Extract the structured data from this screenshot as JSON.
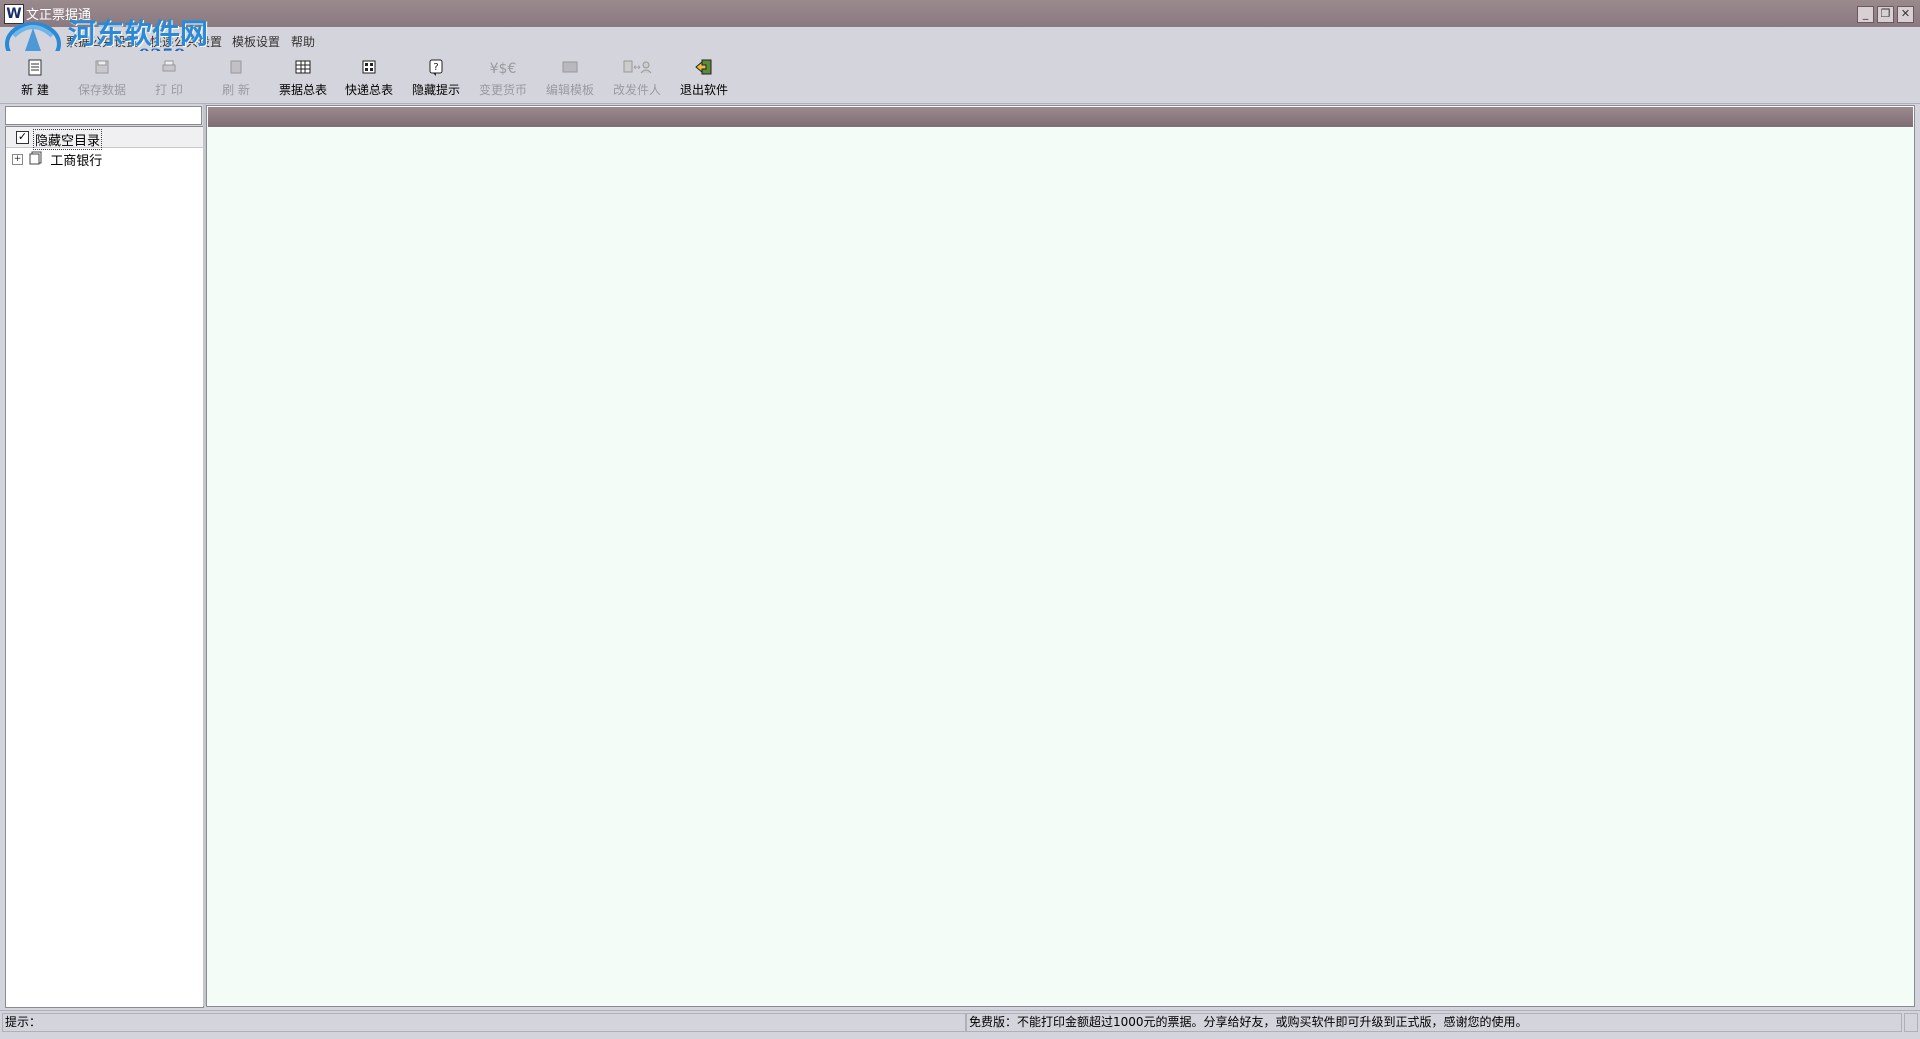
{
  "window": {
    "title": "文正票据通",
    "app_icon": "W"
  },
  "menu": [
    {
      "label": "票据公共设置"
    },
    {
      "label": "快递公共设置"
    },
    {
      "label": "模板设置"
    },
    {
      "label": "帮助"
    }
  ],
  "toolbar": [
    {
      "label": "新 建",
      "icon": "new-file-icon",
      "enabled": true
    },
    {
      "label": "保存数据",
      "icon": "save-icon",
      "enabled": false
    },
    {
      "label": "打 印",
      "icon": "print-icon",
      "enabled": false
    },
    {
      "label": "刷 新",
      "icon": "refresh-icon",
      "enabled": false
    },
    {
      "label": "票据总表",
      "icon": "table-icon",
      "enabled": true
    },
    {
      "label": "快递总表",
      "icon": "express-table-icon",
      "enabled": true
    },
    {
      "label": "隐藏提示",
      "icon": "hint-icon",
      "enabled": true
    },
    {
      "label": "变更货币",
      "icon": "currency-icon",
      "glyph": "¥$€",
      "enabled": false
    },
    {
      "label": "编辑模板",
      "icon": "edit-template-icon",
      "enabled": false
    },
    {
      "label": "改发件人",
      "icon": "change-sender-icon",
      "enabled": false
    },
    {
      "label": "退出软件",
      "icon": "exit-icon",
      "enabled": true
    }
  ],
  "tree": {
    "hide_empty_label": "隐藏空目录",
    "hide_empty_checked": true,
    "nodes": [
      {
        "label": "工商银行",
        "expander": "+"
      }
    ]
  },
  "status": {
    "left": "提示：",
    "right": "免费版：不能打印金额超过1000元的票据。分享给好友，或购买软件即可升级到正式版，感谢您的使用。"
  },
  "watermark": {
    "name": "河东软件网",
    "url": "www.pc0359.cn"
  },
  "colors": {
    "titlebar": "#8a7a80",
    "chrome": "#d4d4dc",
    "main_bg": "#f4fcf7",
    "watermark_blue": "#2a8ad6"
  }
}
